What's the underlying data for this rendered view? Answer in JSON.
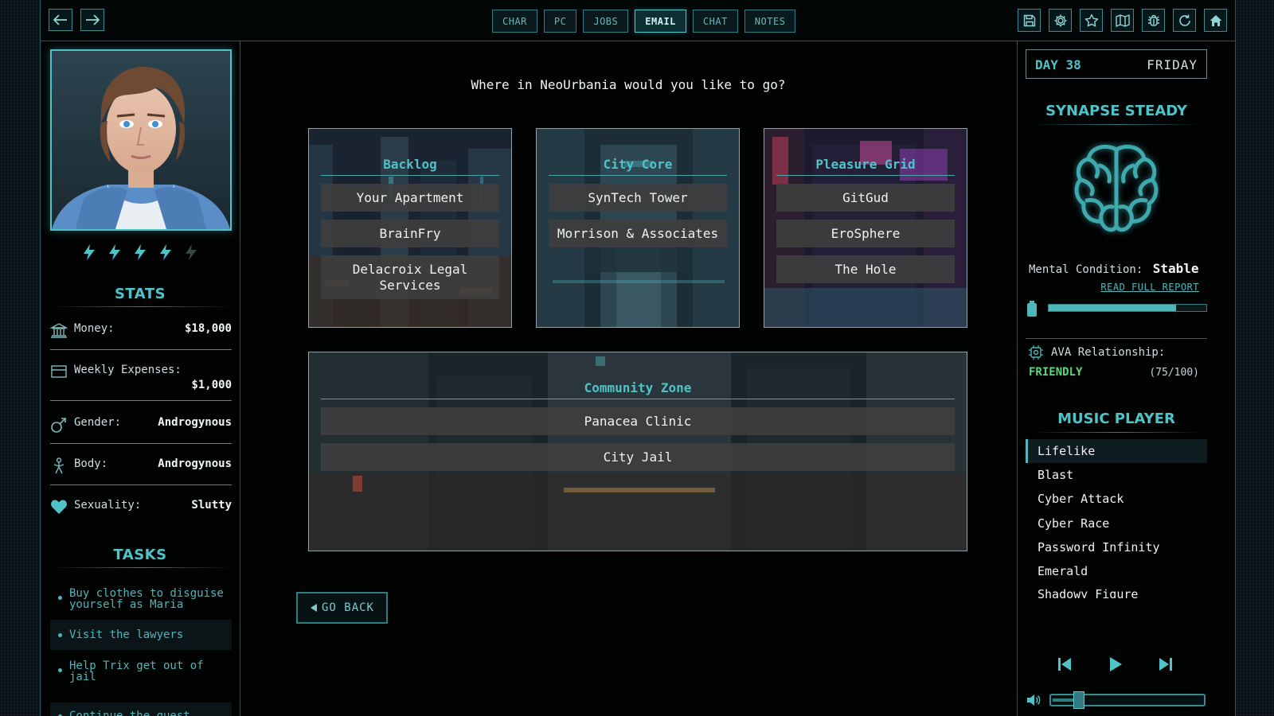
{
  "topbar": {
    "tabs": [
      {
        "label": "CHAR",
        "active": false
      },
      {
        "label": "PC",
        "active": false
      },
      {
        "label": "JOBS",
        "active": false
      },
      {
        "label": "EMAIL",
        "active": true
      },
      {
        "label": "CHAT",
        "active": false
      },
      {
        "label": "NOTES",
        "active": false
      }
    ],
    "icons": [
      "save-icon",
      "settings-icon",
      "star-icon",
      "map-icon",
      "bug-icon",
      "refresh-icon",
      "home-icon"
    ]
  },
  "left": {
    "energy": {
      "filled": 4,
      "total": 5
    },
    "stats_title": "STATS",
    "stats": {
      "money": {
        "label": "Money:",
        "value": "$18,000"
      },
      "expenses": {
        "label": "Weekly Expenses:",
        "value": "$1,000"
      },
      "gender": {
        "label": "Gender:",
        "value": "Androgynous"
      },
      "body": {
        "label": "Body:",
        "value": "Androgynous"
      },
      "sexuality": {
        "label": "Sexuality:",
        "value": "Slutty"
      }
    },
    "tasks_title": "TASKS",
    "tasks": [
      "Buy clothes to disguise yourself as Maria",
      "Visit the lawyers",
      "Help Trix get out of jail",
      "Continue the quest"
    ]
  },
  "main": {
    "question": "Where in NeoUrbania would you like to go?",
    "districts": {
      "backlog": {
        "title": "Backlog",
        "locations": [
          "Your Apartment",
          "BrainFry",
          "Delacroix Legal Services"
        ]
      },
      "city_core": {
        "title": "City Core",
        "locations": [
          "SynTech Tower",
          "Morrison & Associates"
        ]
      },
      "pleasure_grid": {
        "title": "Pleasure Grid",
        "locations": [
          "GitGud",
          "EroSphere",
          "The Hole"
        ]
      },
      "community_zone": {
        "title": "Community Zone",
        "locations": [
          "Panacea Clinic",
          "City Jail"
        ]
      }
    },
    "go_back": "GO BACK"
  },
  "right": {
    "day": "DAY 38",
    "weekday": "FRIDAY",
    "synapse_title": "SYNAPSE STEADY",
    "mental_label": "Mental Condition:",
    "mental_value": "Stable",
    "report_link": "READ FULL REPORT",
    "mental_level": 0.81,
    "ava_label": "AVA Relationship:",
    "ava_status": "FRIENDLY",
    "ava_score": "(75/100)",
    "music_title": "MUSIC PLAYER",
    "tracks": [
      "Lifelike",
      "Blast",
      "Cyber Attack",
      "Cyber Race",
      "Password Infinity",
      "Emerald",
      "Shadowy Figure"
    ],
    "active_track": "Lifelike",
    "volume": 0.16
  },
  "colors": {
    "accent": "#4fc3c8",
    "border": "#1f5a5e",
    "status_ok": "#5fd47a"
  }
}
